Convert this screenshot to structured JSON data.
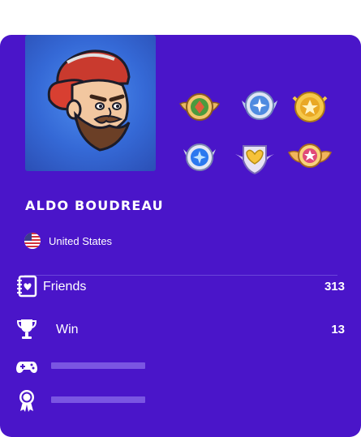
{
  "player": {
    "name": "ALDO BOUDREAU",
    "country": "United States"
  },
  "badges": [
    {
      "name": "green-winged-badge-icon",
      "color": "#5aa64a"
    },
    {
      "name": "blue-star-badge-icon",
      "color": "#5b8fe0"
    },
    {
      "name": "gold-star-badge-icon",
      "color": "#f2b632"
    },
    {
      "name": "blue-gem-badge-icon",
      "color": "#2f7ff0"
    },
    {
      "name": "gold-heart-shield-badge-icon",
      "color": "#f5c23a"
    },
    {
      "name": "pink-winged-star-badge-icon",
      "color": "#e24a7a"
    }
  ],
  "stats": [
    {
      "label": "Friends",
      "value": "313",
      "icon": "heart-notebook-icon"
    },
    {
      "label": "Win",
      "value": "13",
      "icon": "trophy-icon"
    },
    {
      "label": "",
      "value": "",
      "icon": "gamepad-icon"
    },
    {
      "label": "",
      "value": "",
      "icon": "award-ribbon-icon"
    }
  ],
  "colors": {
    "card_background": "#4a15c9",
    "avatar_background": "#3569d6",
    "placeholder_bar": "#7a55e2",
    "text": "#ffffff"
  }
}
